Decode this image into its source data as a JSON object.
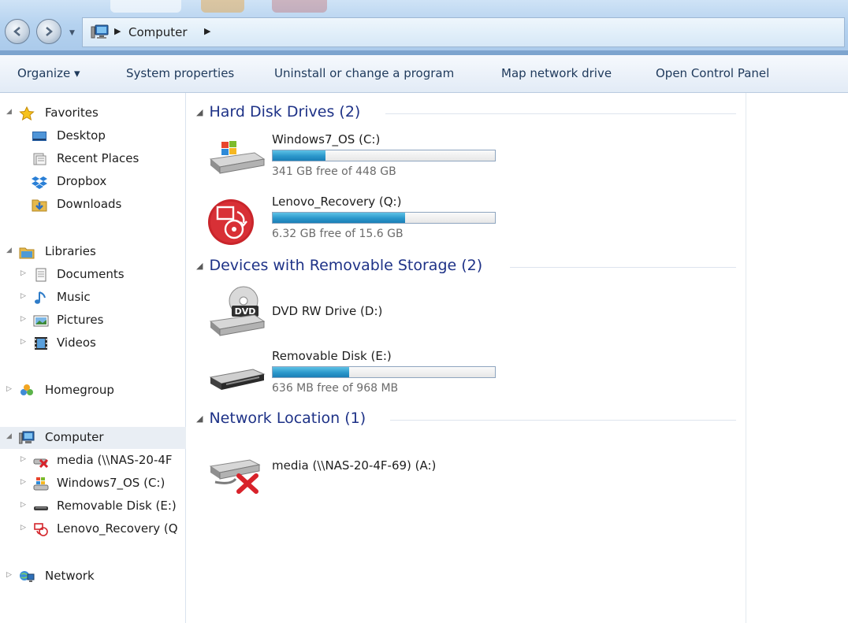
{
  "address_bar": {
    "crumbs": [
      "Computer"
    ]
  },
  "commands": [
    {
      "label": "Organize ▾"
    },
    {
      "label": "System properties"
    },
    {
      "label": "Uninstall or change a program"
    },
    {
      "label": "Map network drive"
    },
    {
      "label": "Open Control Panel"
    }
  ],
  "nav": {
    "favorites": {
      "label": "Favorites",
      "items": [
        "Desktop",
        "Recent Places",
        "Dropbox",
        "Downloads"
      ]
    },
    "libraries": {
      "label": "Libraries",
      "items": [
        "Documents",
        "Music",
        "Pictures",
        "Videos"
      ]
    },
    "homegroup": {
      "label": "Homegroup"
    },
    "computer": {
      "label": "Computer",
      "items": [
        "media (\\\\NAS-20-4F",
        "Windows7_OS (C:)",
        "Removable Disk (E:)",
        "Lenovo_Recovery (Q"
      ]
    },
    "network": {
      "label": "Network"
    }
  },
  "groups": [
    {
      "title": "Hard Disk Drives (2)",
      "drives": [
        {
          "name": "Windows7_OS (C:)",
          "free_text": "341 GB free of 448 GB",
          "used_fraction": 0.239,
          "icon": "windows-drive-icon"
        },
        {
          "name": "Lenovo_Recovery (Q:)",
          "free_text": "6.32 GB free of 15.6 GB",
          "used_fraction": 0.595,
          "icon": "recovery-drive-icon"
        }
      ]
    },
    {
      "title": "Devices with Removable Storage (2)",
      "drives": [
        {
          "name": "DVD RW Drive (D:)",
          "icon": "dvd-drive-icon"
        },
        {
          "name": "Removable Disk (E:)",
          "free_text": "636 MB free of 968 MB",
          "used_fraction": 0.343,
          "icon": "removable-disk-icon"
        }
      ]
    },
    {
      "title": "Network Location (1)",
      "drives": [
        {
          "name": "media (\\\\NAS-20-4F-69) (A:)",
          "icon": "disconnected-network-drive-icon"
        }
      ]
    }
  ],
  "colors": {
    "accent_blue": "#1e3287",
    "bar_fill": "#2b97cb",
    "link_text": "#1e395b"
  }
}
